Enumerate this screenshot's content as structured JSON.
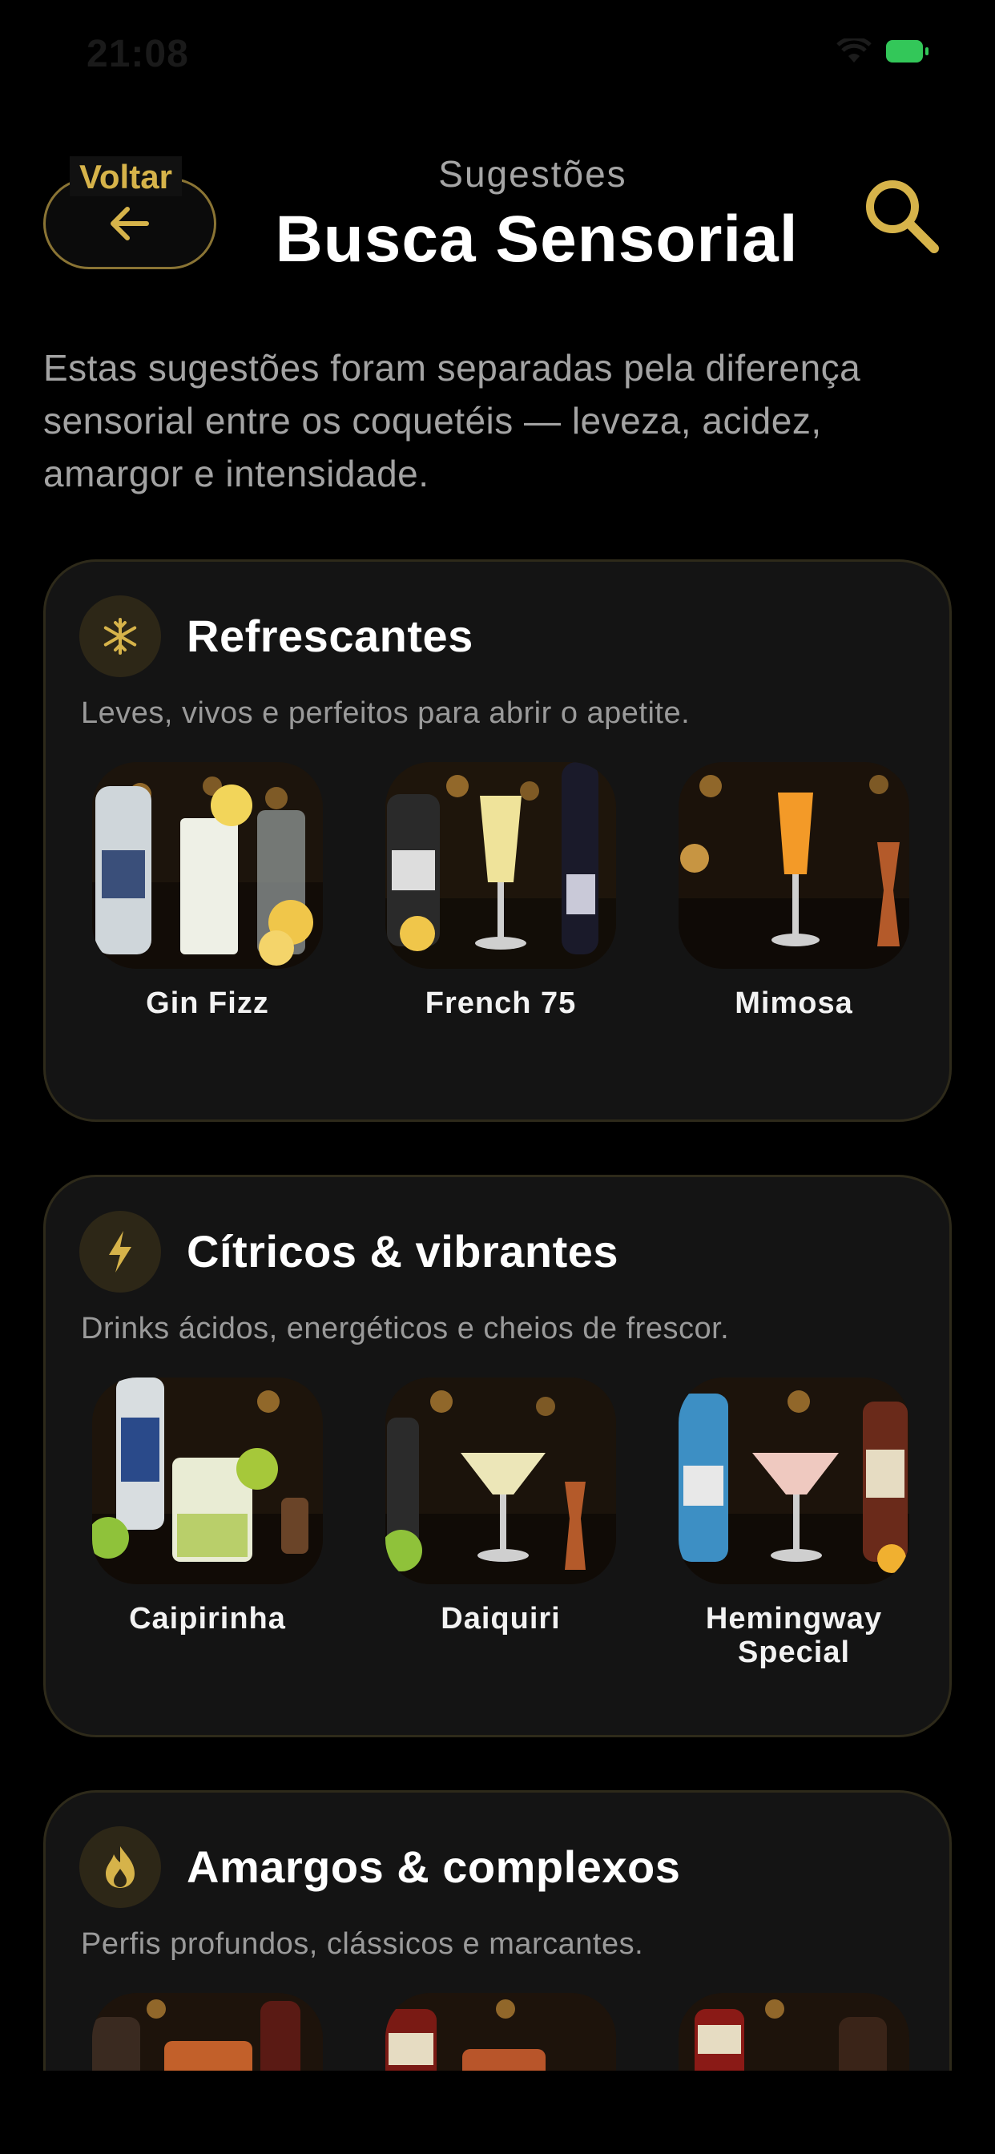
{
  "status_bar": {
    "time": "21:08",
    "icons": [
      "wifi-icon",
      "battery-icon"
    ],
    "battery_color": "#33c759"
  },
  "header": {
    "back_label": "Voltar",
    "eyebrow": "Sugestões",
    "title": "Busca Sensorial",
    "search_icon": "search-icon"
  },
  "intro": "Estas sugestões foram separadas pela diferença sensorial entre os coquetéis — leveza, acidez, amargor e intensidade.",
  "colors": {
    "accent": "#d6b34a",
    "background": "#000000",
    "card": "#141414",
    "card_border": "#2e2a1a"
  },
  "sections": [
    {
      "icon": "snowflake-icon",
      "title": "Refrescantes",
      "subtitle": "Leves, vivos e perfeitos para abrir o apetite.",
      "drinks": [
        {
          "name": "Gin Fizz"
        },
        {
          "name": "French 75"
        },
        {
          "name": "Mimosa"
        }
      ]
    },
    {
      "icon": "lightning-icon",
      "title": "Cítricos & vibrantes",
      "subtitle": "Drinks ácidos, energéticos e cheios de frescor.",
      "drinks": [
        {
          "name": "Caipirinha"
        },
        {
          "name": "Daiquiri"
        },
        {
          "name": "Hemingway Special"
        }
      ]
    },
    {
      "icon": "flame-icon",
      "title": "Amargos & complexos",
      "subtitle": "Perfis profundos, clássicos e marcantes.",
      "drinks": [
        {
          "name": ""
        },
        {
          "name": ""
        },
        {
          "name": ""
        }
      ]
    }
  ]
}
